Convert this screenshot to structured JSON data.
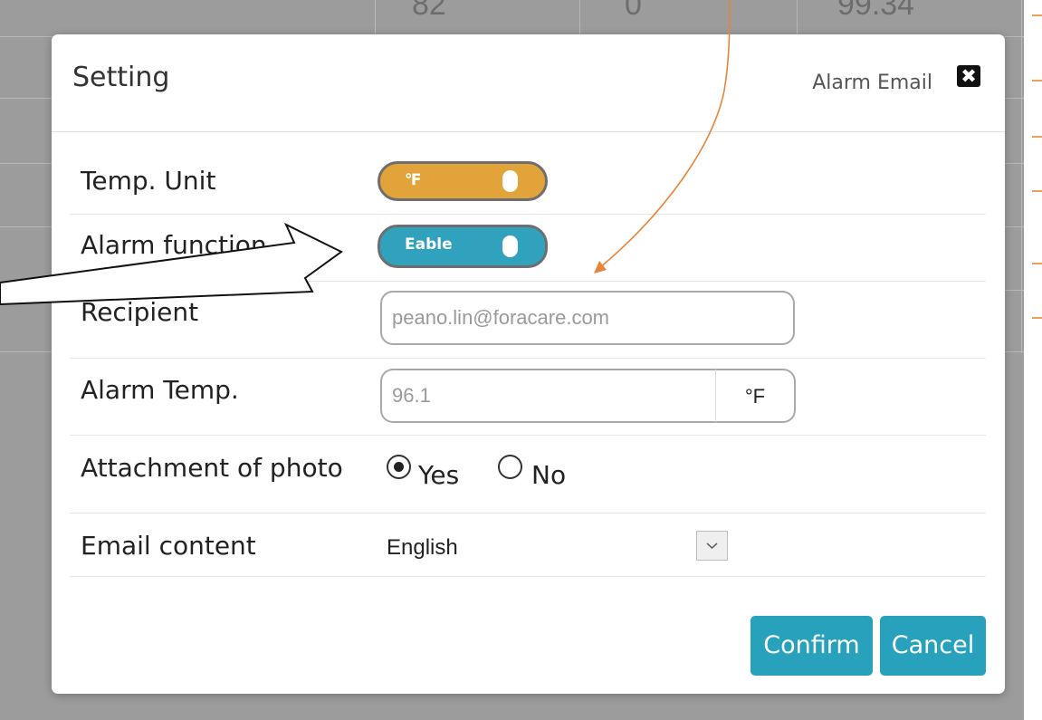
{
  "background": {
    "row_values": [
      "82",
      "0",
      "99.34"
    ]
  },
  "modal": {
    "title": "Setting",
    "subtitle": "Alarm Email",
    "close_symbol": "✖"
  },
  "form": {
    "temp_unit": {
      "label": "Temp. Unit",
      "toggle_text": "℉"
    },
    "alarm_function": {
      "label": "Alarm function",
      "toggle_text": "Eable"
    },
    "recipient": {
      "label": "Recipient",
      "placeholder": "peano.lin@foracare.com"
    },
    "alarm_temp": {
      "label": "Alarm Temp.",
      "placeholder": "96.1",
      "unit": "°F"
    },
    "attachment": {
      "label": "Attachment of photo",
      "options": [
        {
          "label": "Yes",
          "selected": true
        },
        {
          "label": "No",
          "selected": false
        }
      ]
    },
    "email_content": {
      "label": "Email content",
      "value": "English"
    }
  },
  "buttons": {
    "confirm": "Confirm",
    "cancel": "Cancel"
  },
  "colors": {
    "temp_toggle": "#e2a43a",
    "alarm_toggle": "#31a2bd",
    "primary_button": "#28a2bc",
    "annotation_arrow": "#e8843a"
  }
}
